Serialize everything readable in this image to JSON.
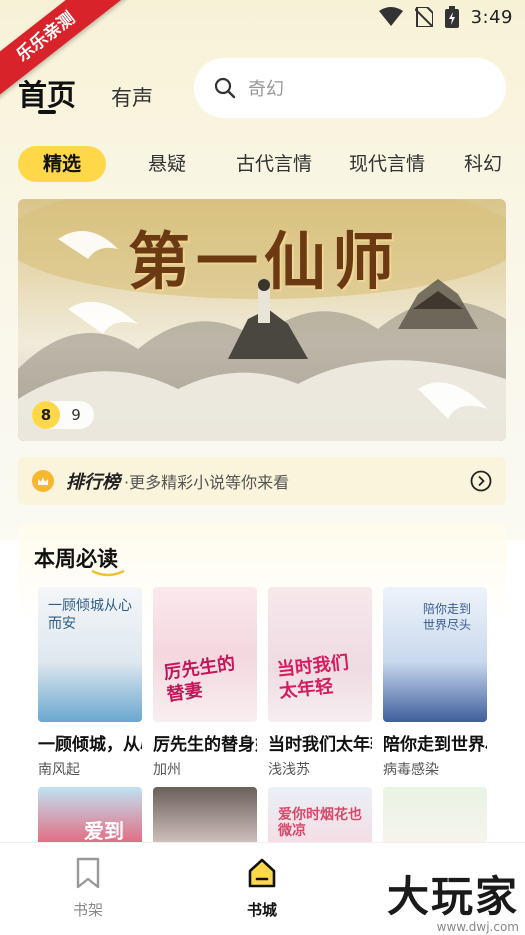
{
  "status_bar": {
    "time": "3:49"
  },
  "ribbon": {
    "text": "乐乐亲测"
  },
  "header": {
    "tab_home": "首页",
    "tab_audio": "有声",
    "search_placeholder": "奇幻"
  },
  "categories": [
    "精选",
    "悬疑",
    "古代言情",
    "现代言情",
    "科幻"
  ],
  "banner": {
    "title": "第一仙师",
    "page_current": "8",
    "page_total": "9"
  },
  "ranking": {
    "title": "排行榜",
    "subtitle": "·更多精彩小说等你来看"
  },
  "weekly": {
    "title": "本周必读",
    "books": [
      {
        "title": "一顾倾城，从心而安",
        "author": "南风起",
        "cover_text": "一顾倾城从心而安",
        "color": "#e9eef3"
      },
      {
        "title": "厉先生的替身娇妻",
        "author": "加州",
        "cover_text": "厉先生的替妻",
        "color": "#f3e7ea"
      },
      {
        "title": "当时我们太年轻",
        "author": "浅浅苏",
        "cover_text": "当时我们太年轻",
        "color": "#f2e6ea"
      },
      {
        "title": "陪你走到世界尽头",
        "author": "病毒感染",
        "cover_text": "陪你走到世界尽头",
        "color": "#dde7f3"
      }
    ],
    "second_row_covers": [
      "爱到",
      "",
      "爱你时烟花也微凉",
      ""
    ]
  },
  "bottom_nav": {
    "items": [
      {
        "label": "书架",
        "active": false
      },
      {
        "label": "书城",
        "active": true
      }
    ]
  },
  "watermark": {
    "main": "大玩家",
    "sub": "www.dwj.com"
  }
}
